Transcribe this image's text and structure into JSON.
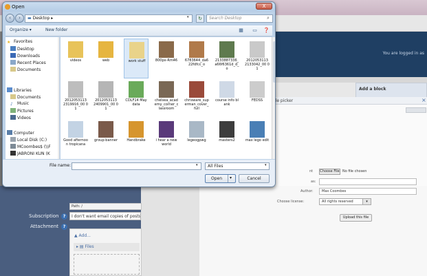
{
  "background": {
    "logged_in_text": "You are logged in as",
    "path_label": "Path: /",
    "subscription_label": "Subscription",
    "subscription_value": "I don't want email copies of posts",
    "attachment_label": "Attachment",
    "add_label": "Add...",
    "files_label": "Files"
  },
  "picker": {
    "add_block": "Add a block",
    "title": "ile picker",
    "choose_file_label": "Choose File",
    "no_file_text": "No file chosen",
    "attach_label": "nt",
    "save_as_label": "as:",
    "author_label": "Author:",
    "author_value": "Max Coombes",
    "license_label": "Choose license:",
    "license_value": "All rights reserved",
    "upload_button": "Upload this file"
  },
  "dialog": {
    "title": "Open",
    "close_label": "X",
    "address": "Desktop",
    "search_placeholder": "Search Desktop",
    "organize": "Organize ▾",
    "new_folder": "New folder",
    "nav": [
      "Favorites",
      "Desktop",
      "Downloads",
      "Recent Places",
      "Documents",
      "Libraries",
      "Documents",
      "Music",
      "Pictures",
      "Videos",
      "Computer",
      "Local Disk (C:)",
      "MCoombes$ (\\\\F",
      "JABRONI KUN (K"
    ],
    "files": [
      "videos",
      "web",
      "work stuff",
      "800px-Rm46",
      "6783644_da622fdfcc_o",
      "2133887336_a66f6361d_d_o",
      "2012053113 2133042_00 01",
      "2012053113 2319916_00 01",
      "2012053113 2409901_00 01",
      "CDLF14 May data",
      "chelsea_academy_corner_classroom",
      "chrisware_superman_cover_full",
      "course info blank",
      "FEDSS",
      "Good afternoon tropicana",
      "group-banner",
      "Handbrake",
      "i hear a new world",
      "legeogpwg",
      "masters2",
      "max lego edit",
      "",
      "",
      "",
      "",
      "",
      "",
      ""
    ],
    "file_name_label": "File name:",
    "file_name_value": "",
    "filter_value": "All Files",
    "open_button": "Open",
    "cancel_button": "Cancel"
  }
}
